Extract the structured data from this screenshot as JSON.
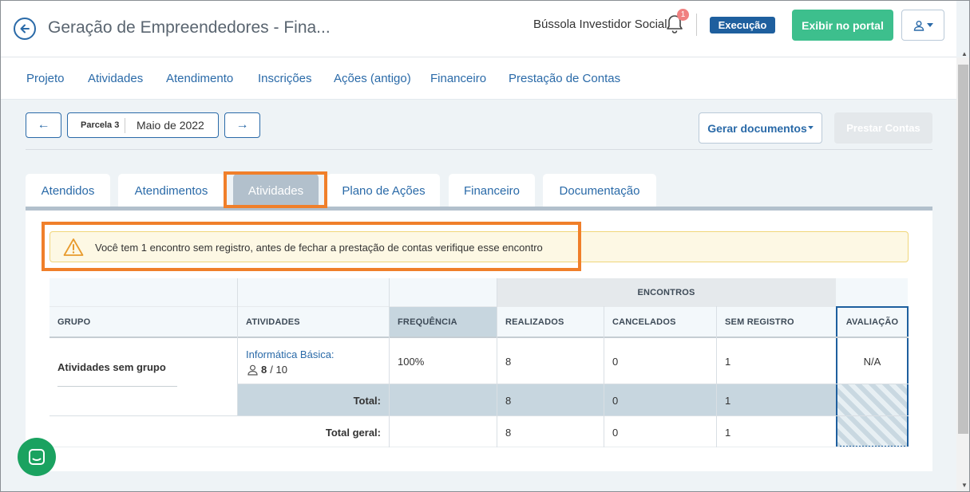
{
  "header": {
    "title": "Geração de Empreendedores - Fina...",
    "org_name": "Bússola Investidor Social",
    "notification_count": "1",
    "status": "Execução",
    "portal_button": "Exibir no portal"
  },
  "nav": {
    "items": [
      "Projeto",
      "Atividades",
      "Atendimento",
      "Inscrições",
      "Ações (antigo)",
      "Financeiro",
      "Prestação de Contas"
    ]
  },
  "period": {
    "prev_arrow": "←",
    "next_arrow": "→",
    "parcela": "Parcela 3",
    "month": "Maio de 2022",
    "gerar_label": "Gerar documentos",
    "prestar_label": "Prestar Contas"
  },
  "tabs": [
    "Atendidos",
    "Atendimentos",
    "Atividades",
    "Plano de Ações",
    "Financeiro",
    "Documentação"
  ],
  "active_tab": "Atividades",
  "alert": {
    "text": "Você tem 1 encontro sem registro, antes de fechar a prestação de contas verifique esse encontro"
  },
  "table": {
    "group_header": "ENCONTROS",
    "columns": {
      "grupo": "GRUPO",
      "atividades": "ATIVIDADES",
      "frequencia": "FREQUÊNCIA",
      "realizados": "REALIZADOS",
      "cancelados": "CANCELADOS",
      "sem_registro": "SEM REGISTRO",
      "avaliacao": "AVALIAÇÃO"
    },
    "row": {
      "grupo": "Atividades sem grupo",
      "atividade": "Informática Básica:",
      "participants": "8",
      "participants_total": "/ 10",
      "frequencia": "100%",
      "realizados": "8",
      "cancelados": "0",
      "sem_registro": "1",
      "avaliacao": "N/A"
    },
    "total": {
      "label": "Total:",
      "realizados": "8",
      "cancelados": "0",
      "sem_registro": "1"
    },
    "total_geral": {
      "label": "Total geral:",
      "realizados": "8",
      "cancelados": "0",
      "sem_registro": "1"
    }
  },
  "colors": {
    "brand_blue": "#2a6aa8",
    "status_bg": "#1e5f9e",
    "portal_green": "#3dbf8d",
    "highlight_orange": "#f07f2a",
    "chat_green": "#1aa260"
  }
}
